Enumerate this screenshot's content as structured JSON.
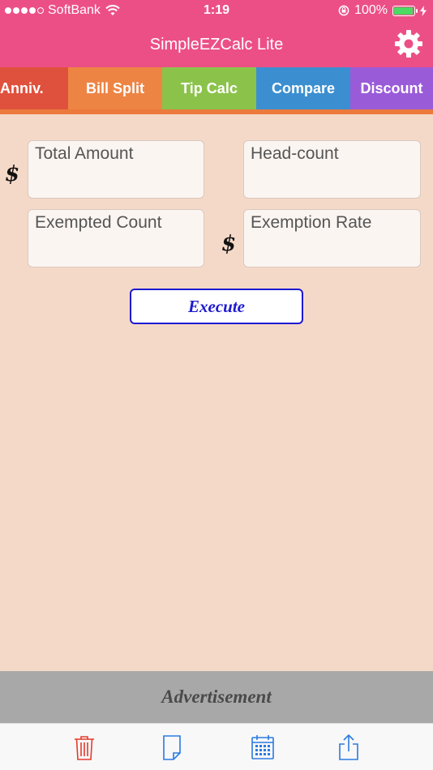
{
  "status": {
    "carrier": "SoftBank",
    "time": "1:19",
    "battery": "100%",
    "signal_bars": 4,
    "wifi_icon": "wifi-icon",
    "lock_icon": "orientation-lock-icon",
    "charging_icon": "charging-bolt-icon"
  },
  "nav": {
    "title": "SimpleEZCalc Lite",
    "settings_icon": "gear-icon"
  },
  "tabs": [
    {
      "label": "Anniv.",
      "color": "#e0513d"
    },
    {
      "label": "Bill Split",
      "color": "#ee8444"
    },
    {
      "label": "Tip Calc",
      "color": "#8bc34a"
    },
    {
      "label": "Compare",
      "color": "#3b8fd0"
    },
    {
      "label": "Discount",
      "color": "#9a5bd9"
    }
  ],
  "form": {
    "total_amount": {
      "placeholder": "Total Amount",
      "value": ""
    },
    "head_count": {
      "placeholder": "Head-count",
      "value": ""
    },
    "exempted_count": {
      "placeholder": "Exempted Count",
      "value": ""
    },
    "exemption_rate": {
      "placeholder": "Exemption Rate",
      "value": ""
    },
    "currency_symbol": "$",
    "execute_label": "Execute"
  },
  "ad": {
    "label": "Advertisement"
  },
  "toolbar": {
    "icons": [
      "trash-icon",
      "document-icon",
      "calendar-icon",
      "share-icon"
    ]
  },
  "colors": {
    "brand_pink": "#ec4f86",
    "background": "#f5d9c8",
    "execute_blue": "#1d1ad0",
    "toolbar_icon_blue": "#2a7ae2",
    "trash_red": "#e53b2c"
  }
}
